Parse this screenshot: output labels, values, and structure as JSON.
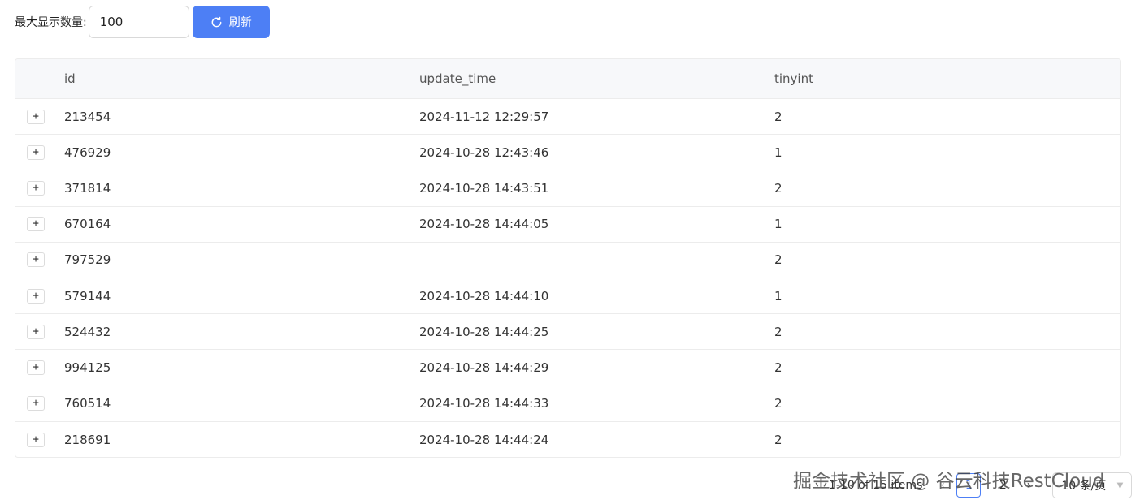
{
  "toolbar": {
    "max_label": "最大显示数量:",
    "max_value": "100",
    "refresh_label": "刷新"
  },
  "table": {
    "columns": [
      "id",
      "update_time",
      "tinyint"
    ],
    "rows": [
      {
        "id": "213454",
        "update_time": "2024-11-12 12:29:57",
        "tinyint": "2"
      },
      {
        "id": "476929",
        "update_time": "2024-10-28 12:43:46",
        "tinyint": "1"
      },
      {
        "id": "371814",
        "update_time": "2024-10-28 14:43:51",
        "tinyint": "2"
      },
      {
        "id": "670164",
        "update_time": "2024-10-28 14:44:05",
        "tinyint": "1"
      },
      {
        "id": "797529",
        "update_time": "",
        "tinyint": "2"
      },
      {
        "id": "579144",
        "update_time": "2024-10-28 14:44:10",
        "tinyint": "1"
      },
      {
        "id": "524432",
        "update_time": "2024-10-28 14:44:25",
        "tinyint": "2"
      },
      {
        "id": "994125",
        "update_time": "2024-10-28 14:44:29",
        "tinyint": "2"
      },
      {
        "id": "760514",
        "update_time": "2024-10-28 14:44:33",
        "tinyint": "2"
      },
      {
        "id": "218691",
        "update_time": "2024-10-28 14:44:24",
        "tinyint": "2"
      }
    ],
    "expand_symbol": "+"
  },
  "pagination": {
    "total_text": "1-10 of 15 items",
    "pages": [
      "1",
      "2"
    ],
    "current_page": "1",
    "page_size_label": "10 条/页"
  },
  "watermark": "掘金技术社区 @ 谷云科技RestCloud",
  "colors": {
    "primary": "#4d7ff5",
    "header_bg": "#f7f8fa",
    "border": "#ececec"
  }
}
